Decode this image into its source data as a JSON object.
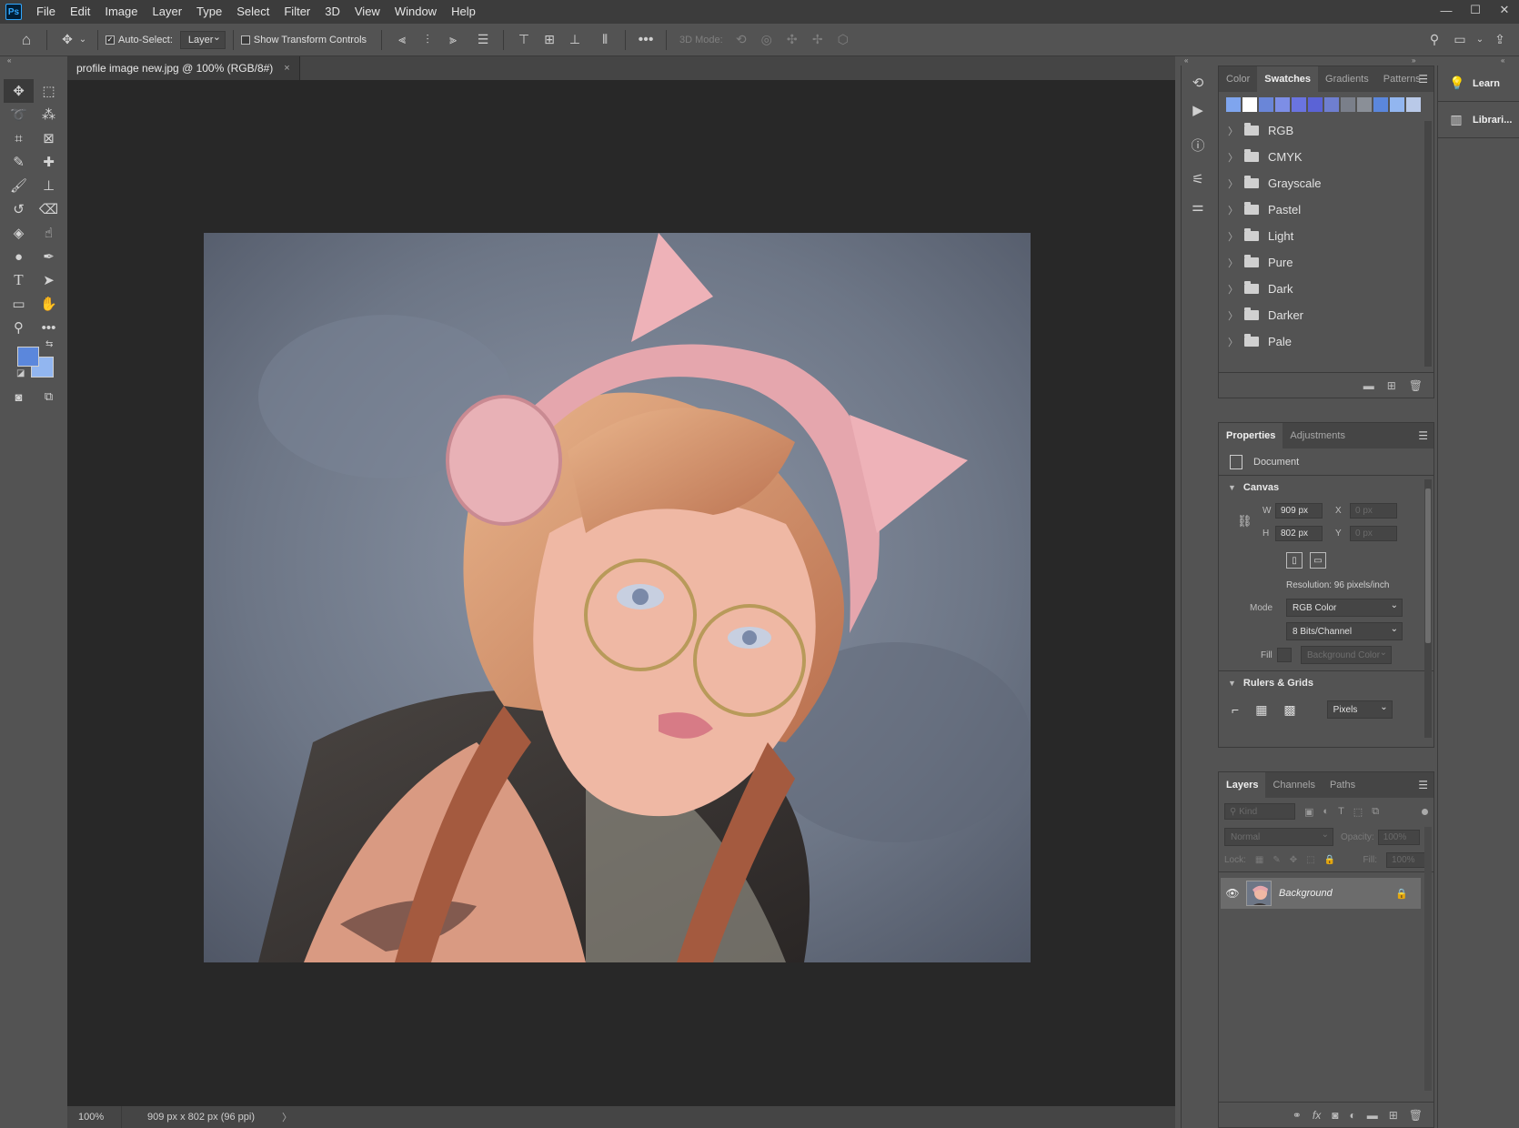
{
  "app": {
    "logo": "Ps"
  },
  "menu": [
    "File",
    "Edit",
    "Image",
    "Layer",
    "Type",
    "Select",
    "Filter",
    "3D",
    "View",
    "Window",
    "Help"
  ],
  "window_controls": {
    "minimize": "—",
    "maximize": "☐",
    "close": "✕"
  },
  "options_bar": {
    "auto_select_label": "Auto-Select:",
    "auto_select_checked": true,
    "auto_select_target": "Layer",
    "show_transform_label": "Show Transform Controls",
    "show_transform_checked": false,
    "mode_3d_label": "3D Mode:"
  },
  "document": {
    "tab_title": "profile image new.jpg @ 100% (RGB/8#)",
    "tab_close": "×",
    "zoom": "100%",
    "info": "909 px x 802 px (96 ppi)",
    "status_chevron": "〉"
  },
  "colors": {
    "foreground": "#5b87dc",
    "background": "#92b6f0"
  },
  "swatches_panel": {
    "tabs": [
      "Color",
      "Swatches",
      "Gradients",
      "Patterns"
    ],
    "active_tab": "Swatches",
    "recent": [
      "#7fa5ee",
      "#ffffff",
      "#6a86d8",
      "#7d8ee6",
      "#6a74e0",
      "#5b63d6",
      "#6f7fd0",
      "#7a7f8a",
      "#8a8f97",
      "#5b87dc",
      "#92b6f0",
      "#b9c9e8"
    ],
    "groups": [
      "RGB",
      "CMYK",
      "Grayscale",
      "Pastel",
      "Light",
      "Pure",
      "Dark",
      "Darker",
      "Pale"
    ]
  },
  "properties_panel": {
    "tabs": [
      "Properties",
      "Adjustments"
    ],
    "active_tab": "Properties",
    "doc_label": "Document",
    "canvas_header": "Canvas",
    "w_label": "W",
    "w_value": "909 px",
    "h_label": "H",
    "h_value": "802 px",
    "x_label": "X",
    "x_value": "0 px",
    "y_label": "Y",
    "y_value": "0 px",
    "resolution": "Resolution: 96 pixels/inch",
    "mode_label": "Mode",
    "mode_value": "RGB Color",
    "bits_value": "8 Bits/Channel",
    "fill_label": "Fill",
    "fill_value": "Background Color",
    "rulers_header": "Rulers & Grids",
    "units_value": "Pixels"
  },
  "layers_panel": {
    "tabs": [
      "Layers",
      "Channels",
      "Paths"
    ],
    "active_tab": "Layers",
    "kind_placeholder": "Kind",
    "blend_mode": "Normal",
    "opacity_label": "Opacity:",
    "opacity_value": "100%",
    "lock_label": "Lock:",
    "fill_label": "Fill:",
    "fill_value": "100%",
    "layers": [
      {
        "name": "Background",
        "visible": true,
        "locked": true
      }
    ]
  },
  "learn_panel": {
    "learn": "Learn",
    "libraries": "Librari..."
  }
}
